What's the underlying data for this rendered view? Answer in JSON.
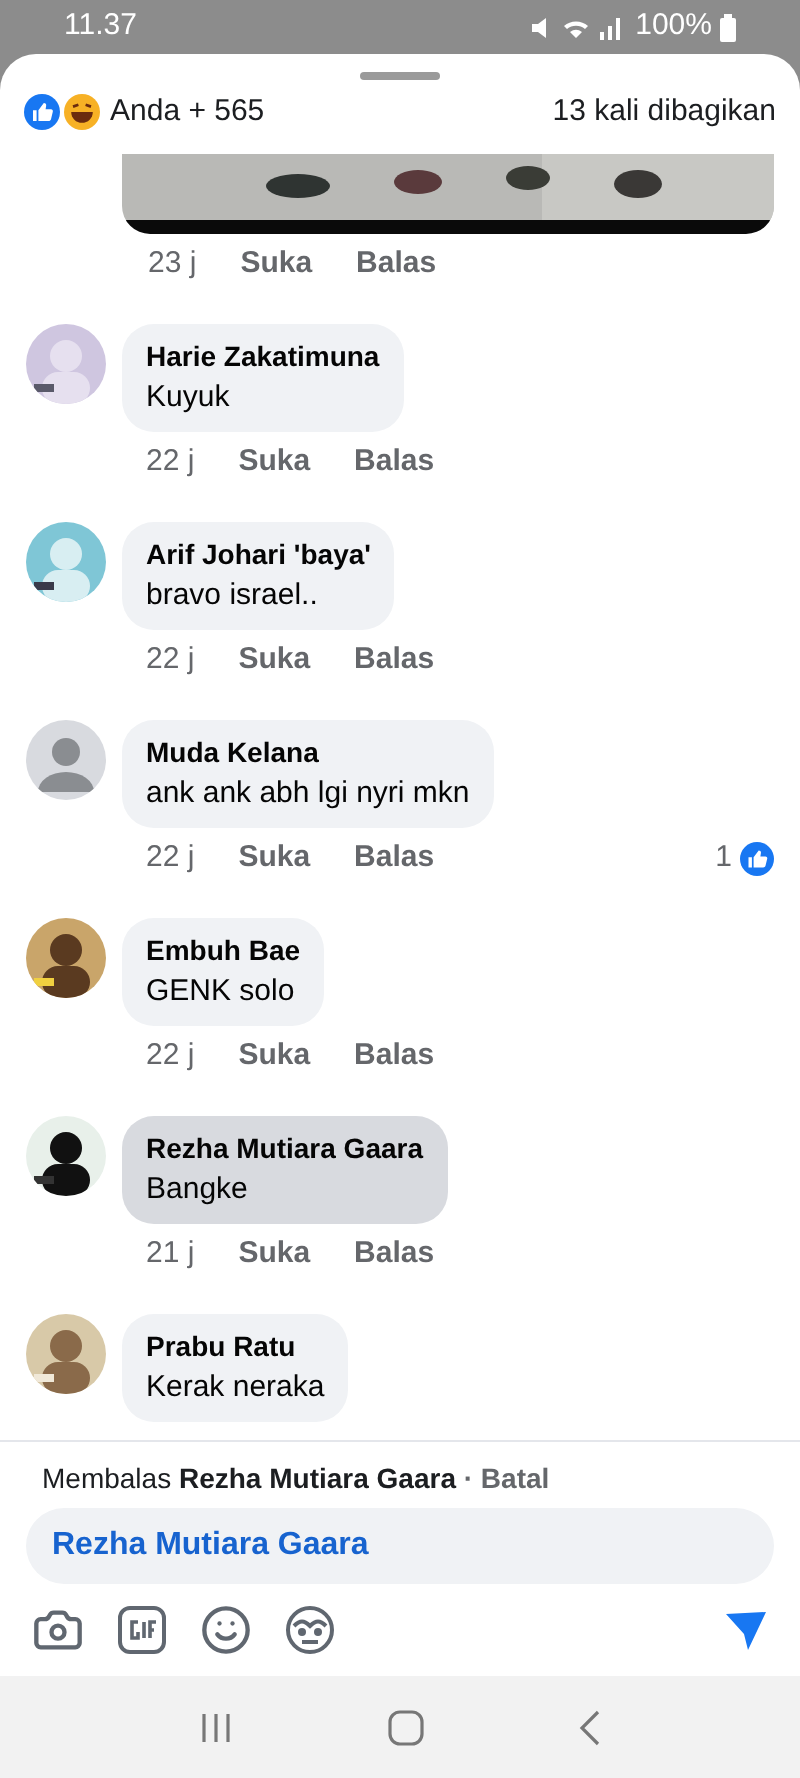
{
  "status_bar": {
    "time": "11.37",
    "battery": "100%"
  },
  "header": {
    "reactions_label": "Anda + 565",
    "shares": "13 kali dibagikan"
  },
  "top_comment_meta": {
    "time": "23 j",
    "like": "Suka",
    "reply": "Balas"
  },
  "comments": [
    {
      "name": "Harie Zakatimuna",
      "text": "Kuyuk",
      "time": "22 j",
      "like": "Suka",
      "reply": "Balas",
      "selected": false
    },
    {
      "name": "Arif Johari 'baya'",
      "text": "bravo israel..",
      "time": "22 j",
      "like": "Suka",
      "reply": "Balas",
      "selected": false
    },
    {
      "name": "Muda Kelana",
      "text": "ank ank abh lgi nyri mkn",
      "time": "22 j",
      "like": "Suka",
      "reply": "Balas",
      "selected": false,
      "avatar": {
        "kind": "default"
      },
      "likes": "1"
    },
    {
      "name": "Embuh Bae",
      "text": "GENK solo",
      "time": "22 j",
      "like": "Suka",
      "reply": "Balas",
      "selected": false
    },
    {
      "name": "Rezha Mutiara Gaara",
      "text": "Bangke",
      "time": "21 j",
      "like": "Suka",
      "reply": "Balas",
      "selected": true
    },
    {
      "name": "Prabu Ratu",
      "text": "Kerak neraka",
      "selected": false
    }
  ],
  "reply_bar": {
    "prefix": "Membalas",
    "target": "Rezha Mutiara Gaara",
    "cancel": "· Batal"
  },
  "composer": {
    "value": "Rezha Mutiara Gaara"
  }
}
